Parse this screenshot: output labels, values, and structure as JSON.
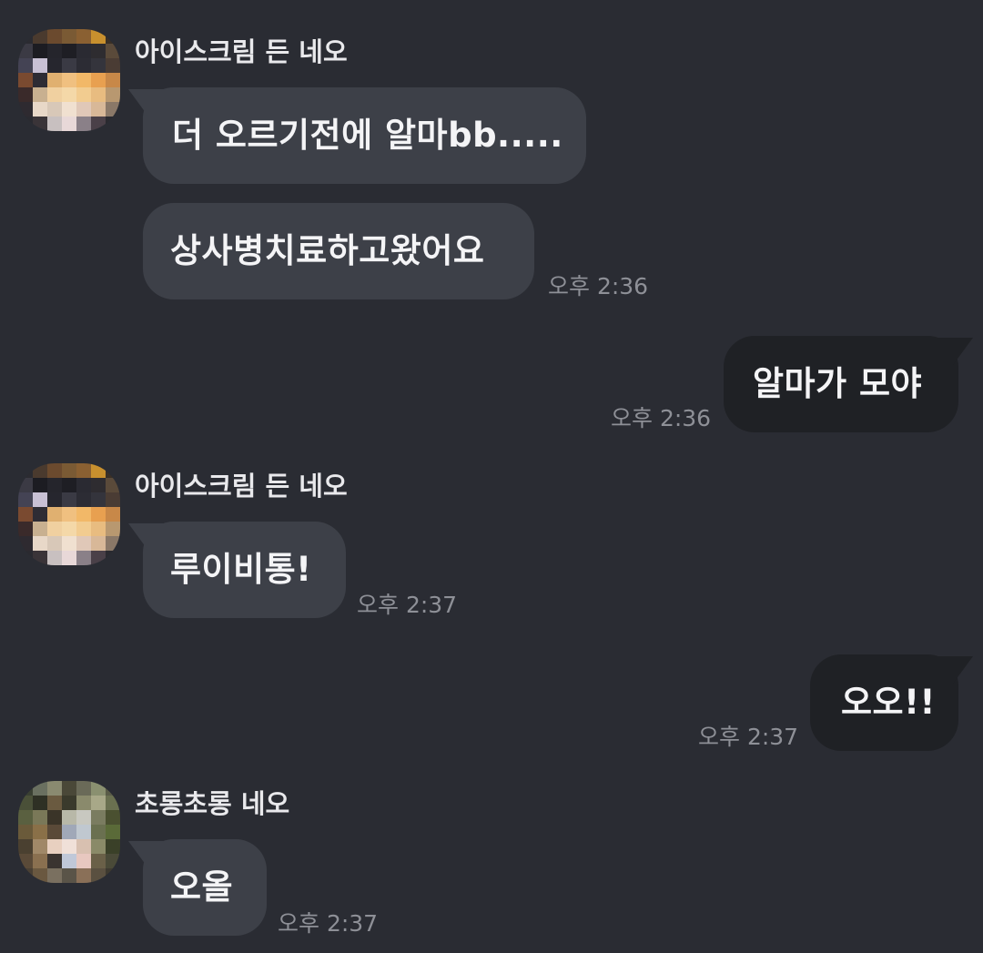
{
  "messages": [
    {
      "sender": "아이스크림 든 네오",
      "bubbles": [
        "더 오르기전에 알마bb.....",
        "상사병치료하고왔어요"
      ],
      "time": "오후 2:36"
    },
    {
      "outgoing": true,
      "bubbles": [
        "알마가 모야"
      ],
      "time": "오후 2:36"
    },
    {
      "sender": "아이스크림 든 네오",
      "bubbles": [
        "루이비통!"
      ],
      "time": "오후 2:37"
    },
    {
      "outgoing": true,
      "bubbles": [
        "오오!!"
      ],
      "time": "오후 2:37"
    },
    {
      "sender": "초롱초롱 네오",
      "bubbles": [
        "오올"
      ],
      "time": "오후 2:37"
    }
  ],
  "colors": {
    "background": "#2a2c33",
    "incoming_bubble": "#3d4048",
    "outgoing_bubble": "#1f2125",
    "text": "#f4f4f6",
    "time": "#8e9097"
  }
}
